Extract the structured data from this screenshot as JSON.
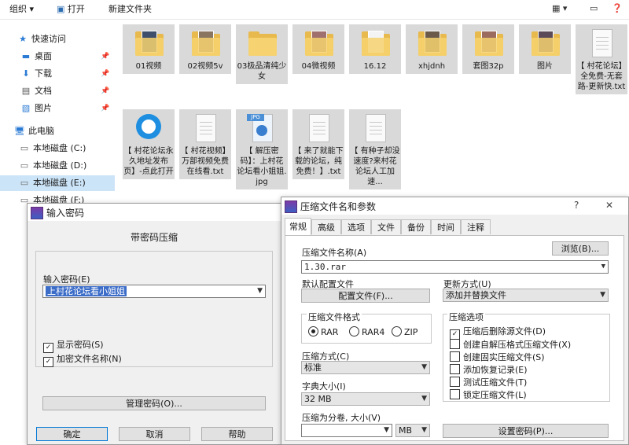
{
  "explorer": {
    "toolbar": {
      "organize": "组织 ▾",
      "open": "打开",
      "new_folder": "新建文件夹"
    },
    "nav": [
      {
        "label": "快速访问",
        "icon": "star-icon",
        "pinned": false
      },
      {
        "label": "桌面",
        "icon": "desktop-icon",
        "pinned": true
      },
      {
        "label": "下载",
        "icon": "download-icon",
        "pinned": true
      },
      {
        "label": "文档",
        "icon": "document-icon",
        "pinned": true
      },
      {
        "label": "图片",
        "icon": "picture-icon",
        "pinned": true
      },
      {
        "label": "此电脑",
        "icon": "computer-icon",
        "pinned": false
      },
      {
        "label": "本地磁盘 (C:)",
        "icon": "drive-icon",
        "pinned": false
      },
      {
        "label": "本地磁盘 (D:)",
        "icon": "drive-icon",
        "pinned": false
      },
      {
        "label": "本地磁盘 (E:)",
        "icon": "drive-icon",
        "pinned": false,
        "selected": true
      },
      {
        "label": "本地磁盘 (F:)",
        "icon": "drive-icon",
        "pinned": false
      }
    ],
    "files": [
      {
        "name": "01视频",
        "kind": "folder"
      },
      {
        "name": "02视频5v",
        "kind": "folder"
      },
      {
        "name": "03极品清纯少女",
        "kind": "folder"
      },
      {
        "name": "04微视频",
        "kind": "folder"
      },
      {
        "name": "16.12",
        "kind": "folder"
      },
      {
        "name": "xhjdnh",
        "kind": "folder"
      },
      {
        "name": "套图32p",
        "kind": "folder"
      },
      {
        "name": "图片",
        "kind": "folder"
      },
      {
        "name": "【 村花论坛】全免费-无套路-更新快.txt",
        "kind": "txt"
      },
      {
        "name": "【 村花论坛永久地址发布页】-点此打开",
        "kind": "link"
      },
      {
        "name": "【 村花视频】万部视频免费在线看.txt",
        "kind": "txt"
      },
      {
        "name": "【 解压密码】：上村花论坛看小姐姐.jpg",
        "kind": "jpg"
      },
      {
        "name": "【 来了就能下载的论坛，纯免费！】.txt",
        "kind": "txt"
      },
      {
        "name": "【 有种子却没速度?来村花论坛人工加速...",
        "kind": "txt"
      }
    ]
  },
  "password_dialog": {
    "title": "输入密码",
    "heading": "带密码压缩",
    "password_label": "输入密码(E)",
    "password_value": "上村花论坛看小姐姐",
    "show_password": "显示密码(S)",
    "encrypt_names": "加密文件名称(N)",
    "manage_button": "管理密码(O)...",
    "ok": "确定",
    "cancel": "取消",
    "help": "帮助"
  },
  "archive_dialog": {
    "title": "压缩文件名和参数",
    "tabs": [
      "常规",
      "高级",
      "选项",
      "文件",
      "备份",
      "时间",
      "注释"
    ],
    "archive_name_label": "压缩文件名称(A)",
    "browse_button": "浏览(B)...",
    "archive_name_value": "1.30.rar",
    "default_profile_label": "默认配置文件",
    "profile_button": "配置文件(F)...",
    "update_mode_label": "更新方式(U)",
    "update_mode_value": "添加并替换文件",
    "format_group": "压缩文件格式",
    "formats": [
      "RAR",
      "RAR4",
      "ZIP"
    ],
    "selected_format": "RAR",
    "method_label": "压缩方式(C)",
    "method_value": "标准",
    "dict_label": "字典大小(I)",
    "dict_value": "32 MB",
    "split_label": "压缩为分卷, 大小(V)",
    "split_value": "",
    "split_unit": "MB",
    "options_group": "压缩选项",
    "options": [
      {
        "label": "压缩后删除源文件(D)",
        "checked": true
      },
      {
        "label": "创建自解压格式压缩文件(X)",
        "checked": false
      },
      {
        "label": "创建固实压缩文件(S)",
        "checked": false
      },
      {
        "label": "添加恢复记录(E)",
        "checked": false
      },
      {
        "label": "测试压缩文件(T)",
        "checked": false
      },
      {
        "label": "锁定压缩文件(L)",
        "checked": false
      }
    ],
    "set_password_button": "设置密码(P)..."
  }
}
